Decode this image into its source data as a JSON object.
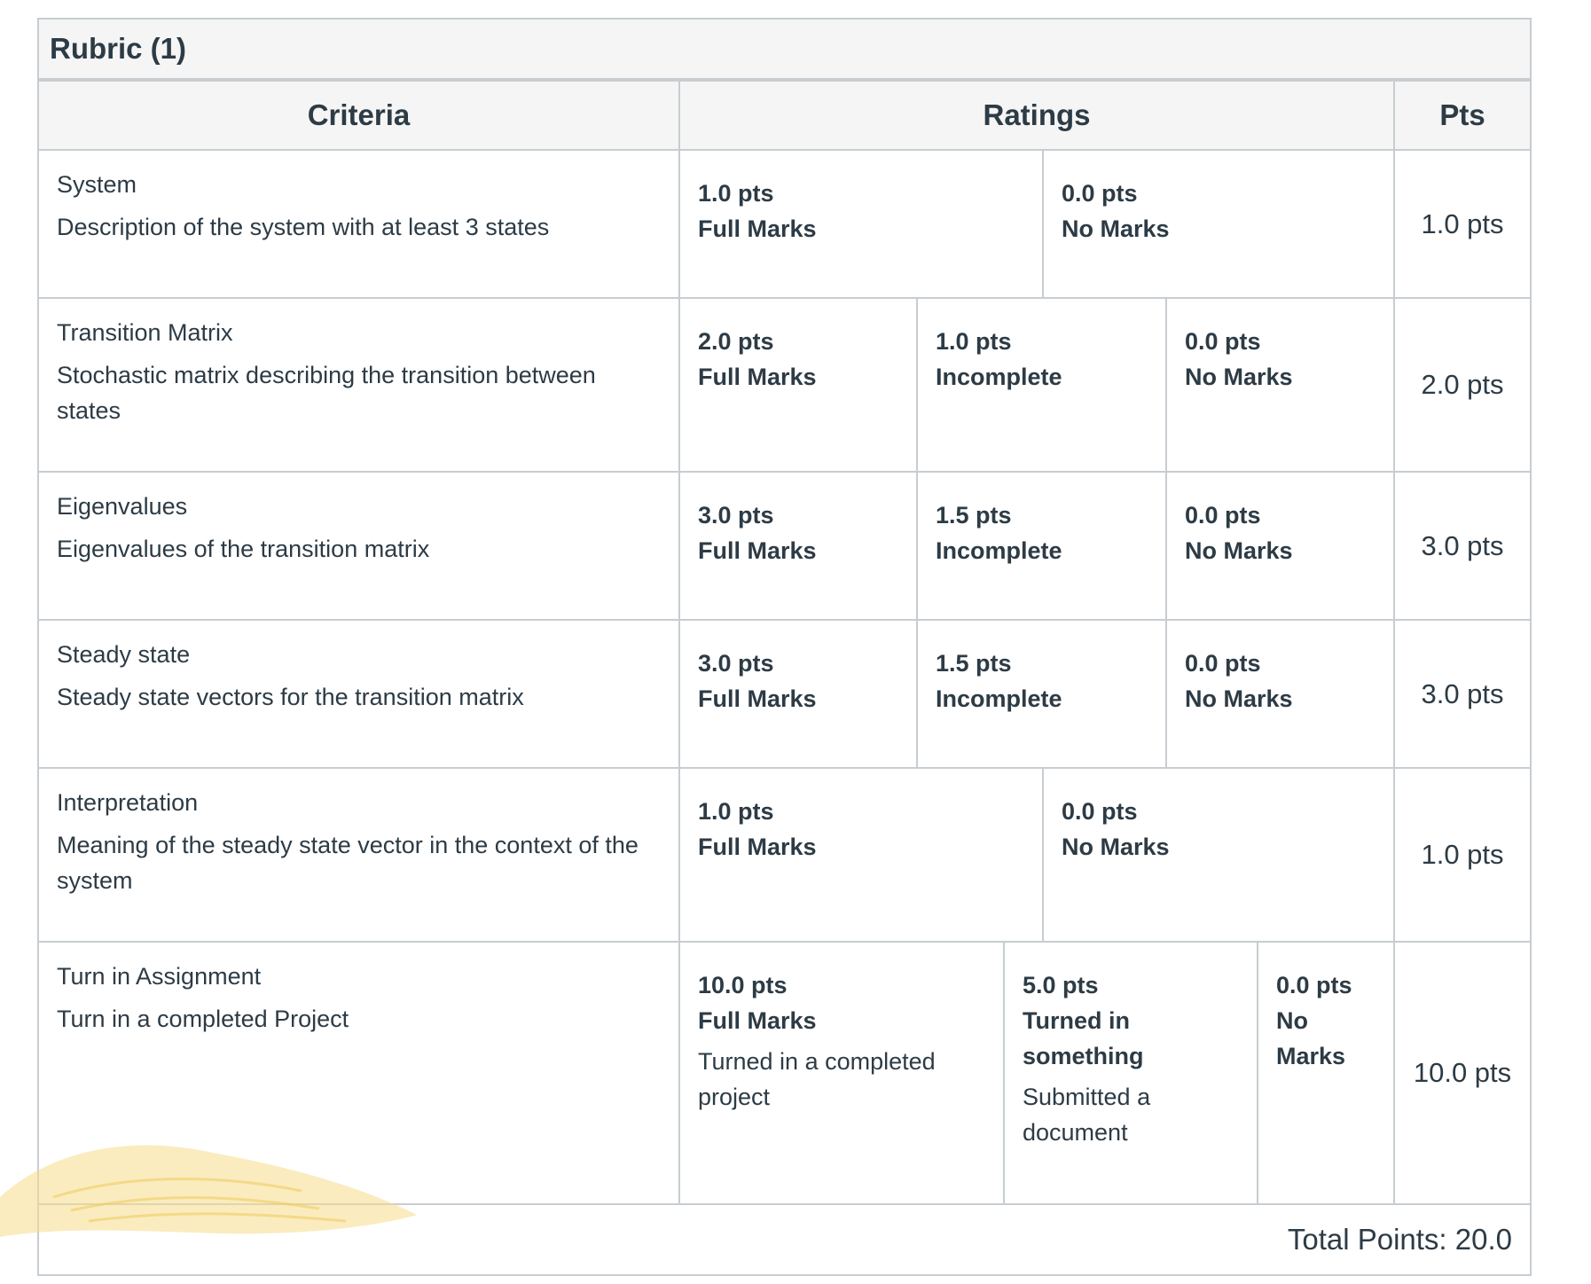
{
  "rubric_title": "Rubric (1)",
  "headers": {
    "criteria": "Criteria",
    "ratings": "Ratings",
    "pts": "Pts"
  },
  "rows": [
    {
      "name": "System",
      "description": "Description of the system with at least 3 states",
      "ratings": [
        {
          "pts": "1.0 pts",
          "label": "Full Marks"
        },
        {
          "pts": "0.0 pts",
          "label": "No Marks"
        }
      ],
      "points": "1.0 pts"
    },
    {
      "name": "Transition Matrix",
      "description": "Stochastic matrix describing the transition between states",
      "ratings": [
        {
          "pts": "2.0 pts",
          "label": "Full Marks"
        },
        {
          "pts": "1.0 pts",
          "label": "Incomplete"
        },
        {
          "pts": "0.0 pts",
          "label": "No Marks"
        }
      ],
      "points": "2.0 pts"
    },
    {
      "name": "Eigenvalues",
      "description": "Eigenvalues of the transition matrix",
      "ratings": [
        {
          "pts": "3.0 pts",
          "label": "Full Marks"
        },
        {
          "pts": "1.5 pts",
          "label": "Incomplete"
        },
        {
          "pts": "0.0 pts",
          "label": "No Marks"
        }
      ],
      "points": "3.0 pts"
    },
    {
      "name": "Steady state",
      "description": "Steady state vectors for the transition matrix",
      "ratings": [
        {
          "pts": "3.0 pts",
          "label": "Full Marks"
        },
        {
          "pts": "1.5 pts",
          "label": "Incomplete"
        },
        {
          "pts": "0.0 pts",
          "label": "No Marks"
        }
      ],
      "points": "3.0 pts"
    },
    {
      "name": "Interpretation",
      "description": "Meaning of the steady state vector in the context of the system",
      "ratings": [
        {
          "pts": "1.0 pts",
          "label": "Full Marks"
        },
        {
          "pts": "0.0 pts",
          "label": "No Marks"
        }
      ],
      "points": "1.0 pts"
    },
    {
      "name": "Turn in Assignment",
      "description": "Turn in a completed Project",
      "ratings": [
        {
          "pts": "10.0 pts",
          "label": "Full Marks",
          "description": "Turned in a completed project"
        },
        {
          "pts": "5.0 pts",
          "label": "Turned in something",
          "description": "Submitted a document"
        },
        {
          "pts": "0.0 pts",
          "label": "No Marks"
        }
      ],
      "points": "10.0 pts"
    }
  ],
  "total_points": "Total Points: 20.0",
  "colors": {
    "border": "#c7cdd1",
    "header_bg": "#f5f5f5",
    "text": "#2d3b45",
    "decor": "#f6dc8a"
  }
}
